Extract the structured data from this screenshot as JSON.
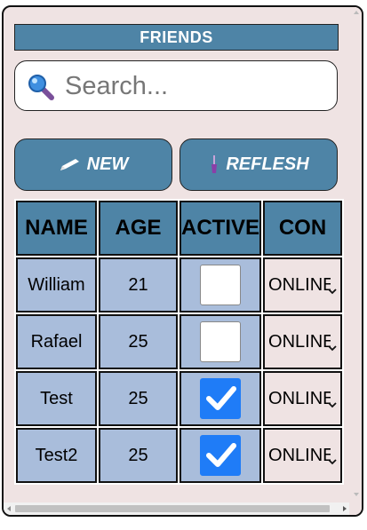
{
  "header": {
    "title": "FRIENDS"
  },
  "search": {
    "placeholder": "Search...",
    "value": ""
  },
  "buttons": {
    "new_label": "NEW",
    "refresh_label": "REFLESH"
  },
  "table": {
    "columns": [
      "NAME",
      "AGE",
      "ACTIVE",
      "CON"
    ],
    "rows": [
      {
        "name": "William",
        "age": "21",
        "active": false,
        "con": "ONLINE"
      },
      {
        "name": "Rafael",
        "age": "25",
        "active": false,
        "con": "ONLINE"
      },
      {
        "name": "Test",
        "age": "25",
        "active": true,
        "con": "ONLINE"
      },
      {
        "name": "Test2",
        "age": "25",
        "active": true,
        "con": "ONLINE"
      }
    ]
  },
  "colors": {
    "accent": "#4e84a6",
    "row_bg": "#a9bddb",
    "panel_bg": "#efe3e3",
    "checkbox_checked": "#1f7cf7"
  },
  "icons": {
    "search": "magnifier-icon",
    "new": "pencil-icon",
    "refresh": "brush-icon",
    "dropdown": "chevron-down-icon"
  }
}
